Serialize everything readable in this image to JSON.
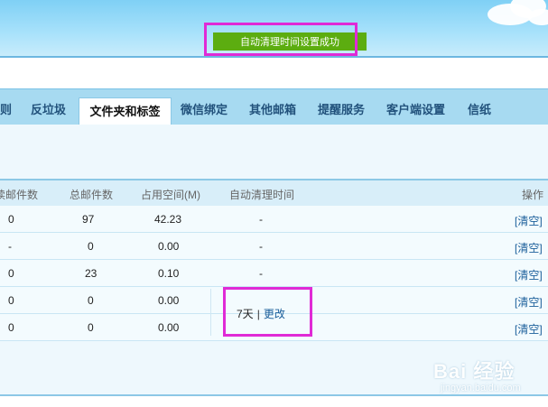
{
  "notice": {
    "text": "自动清理时间设置成功"
  },
  "tabs": [
    {
      "label": "则"
    },
    {
      "label": "反垃圾"
    },
    {
      "label": "文件夹和标签",
      "active": true
    },
    {
      "label": "微信绑定"
    },
    {
      "label": "其他邮箱"
    },
    {
      "label": "提醒服务"
    },
    {
      "label": "客户端设置"
    },
    {
      "label": "信纸"
    }
  ],
  "table": {
    "headers": {
      "unread": "读邮件数",
      "total": "总邮件数",
      "space": "占用空间(M)",
      "auto_clean": "自动清理时间",
      "action": "操作"
    },
    "rows": [
      {
        "unread": "0",
        "total": "97",
        "space": "42.23",
        "auto_clean": "-",
        "action": "[清空]"
      },
      {
        "unread": "-",
        "total": "0",
        "space": "0.00",
        "auto_clean": "-",
        "action": "[清空]"
      },
      {
        "unread": "0",
        "total": "23",
        "space": "0.10",
        "auto_clean": "-",
        "action": "[清空]"
      },
      {
        "unread": "0",
        "total": "0",
        "space": "0.00",
        "auto_clean": "",
        "action": "[清空]"
      },
      {
        "unread": "0",
        "total": "0",
        "space": "0.00",
        "auto_clean": "",
        "action": "[清空]"
      }
    ],
    "auto_clean_setting": {
      "value": "7天",
      "separator": "|",
      "edit_link": "更改"
    }
  },
  "watermark": {
    "main": "Bai 经验",
    "sub": "jingyan.baidu.com"
  },
  "colors": {
    "highlight": "#e02ad6",
    "notice_bg": "#5cad10",
    "tab_bar": "#a7daf1",
    "link": "#1a5e9a"
  }
}
